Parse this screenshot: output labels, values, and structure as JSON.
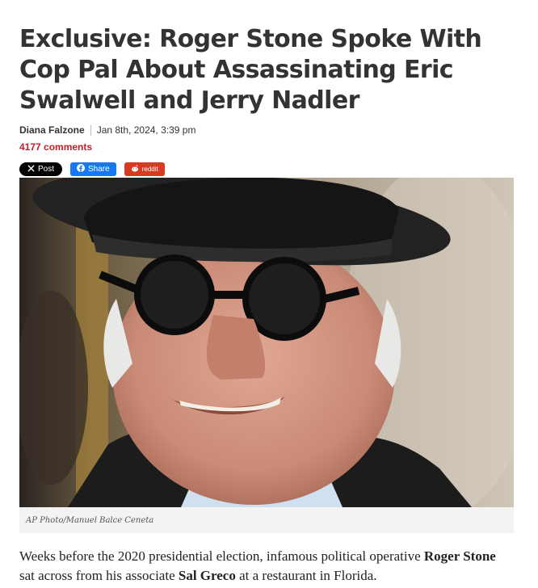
{
  "article": {
    "headline": "Exclusive: Roger Stone Spoke With Cop Pal About Assassinating Eric Swalwell and Jerry Nadler",
    "author": "Diana Falzone",
    "date": "Jan 8th, 2024, 3:39 pm",
    "comments": "4177 comments"
  },
  "share": {
    "x_label": "Post",
    "facebook_label": "Share",
    "reddit_label": "reddit"
  },
  "photo": {
    "caption": "AP Photo/Manuel Balce Ceneta"
  },
  "body": {
    "p1_a": "Weeks before the 2020 presidential election, infamous political operative ",
    "p1_b": "Roger Stone",
    "p1_c": " sat across from his associate ",
    "p1_d": "Sal Greco",
    "p1_e": " at a restaurant in Florida."
  },
  "colors": {
    "comments": "#c0202a",
    "facebook": "#1877f2",
    "reddit": "#d53b21",
    "x": "#000000"
  }
}
